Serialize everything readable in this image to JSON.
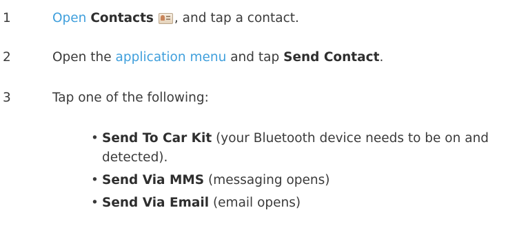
{
  "steps": [
    {
      "number": "1",
      "link": "Open",
      "bold": "Contacts",
      "icon": "contacts-app-icon",
      "after": ", and tap a contact."
    },
    {
      "number": "2",
      "before": "Open the ",
      "link": "application menu",
      "middle": " and tap ",
      "bold": "Send Contact",
      "after": "."
    },
    {
      "number": "3",
      "text": "Tap one of the following:"
    }
  ],
  "options": [
    {
      "bullet": "•",
      "bold": "Send To Car Kit",
      "desc_line1": " (your Bluetooth device needs to be on and",
      "desc_line2": "detected)."
    },
    {
      "bullet": "•",
      "bold": "Send Via MMS",
      "desc": " (messaging opens)"
    },
    {
      "bullet": "•",
      "bold": "Send Via Email",
      "desc": " (email opens)"
    }
  ],
  "colors": {
    "link": "#3f9fdc",
    "text": "#3a3a3a"
  }
}
